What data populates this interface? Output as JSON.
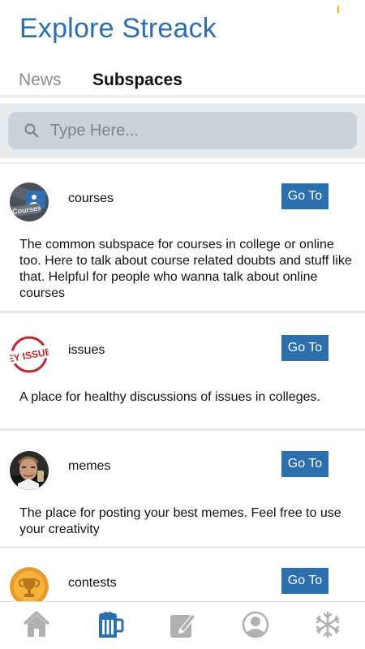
{
  "app": {
    "title": "Explore Streack"
  },
  "tabs": [
    {
      "label": "News",
      "active": false
    },
    {
      "label": "Subspaces",
      "active": true
    }
  ],
  "search": {
    "placeholder": "Type Here..."
  },
  "subspaces": [
    {
      "name": "courses",
      "avatar_text": "Courses",
      "button": "Go To",
      "description": "The common subspace for courses in college or online too. Here to talk about course related doubts and stuff like that. Helpful for people who wanna talk about online courses"
    },
    {
      "name": "issues",
      "avatar_text": "EY ISSUE",
      "button": "Go To",
      "description": "A place for healthy discussions of issues in colleges."
    },
    {
      "name": "memes",
      "button": "Go To",
      "description": "The place for posting your best memes. Feel free to use your creativity"
    },
    {
      "name": "contests",
      "button": "Go To",
      "description": ""
    }
  ],
  "bottom_nav": [
    {
      "icon": "home-icon",
      "active": false
    },
    {
      "icon": "mug-icon",
      "active": true
    },
    {
      "icon": "compose-icon",
      "active": false
    },
    {
      "icon": "profile-icon",
      "active": false
    },
    {
      "icon": "snowflake-icon",
      "active": false
    }
  ],
  "colors": {
    "accent": "#2b6fad",
    "inactive_icon": "#b0b0b0",
    "search_band": "#e6ebf0",
    "search_box": "#c9d1d9"
  }
}
